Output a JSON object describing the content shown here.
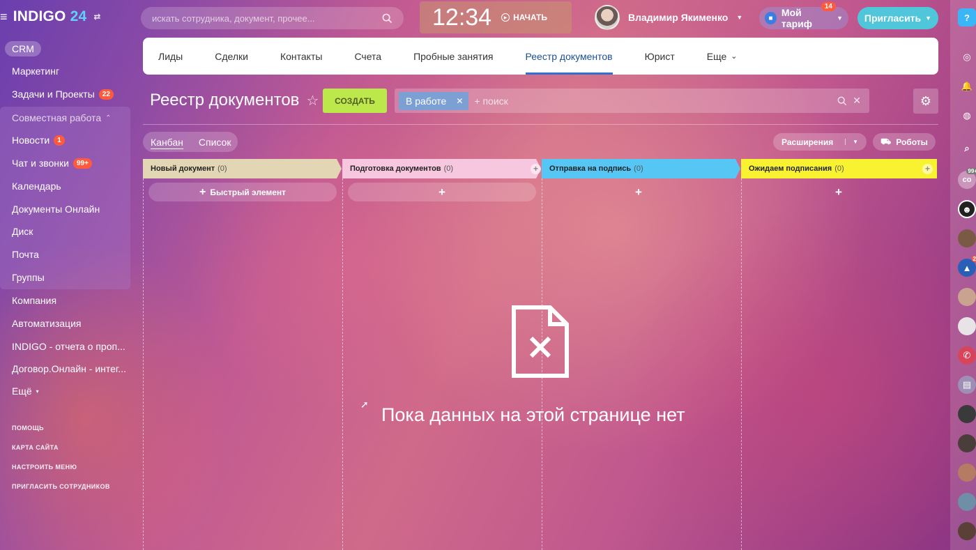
{
  "header": {
    "logo_text": "INDIGO",
    "logo_num": "24",
    "search_placeholder": "искать сотрудника, документ, прочее...",
    "time": "12:34",
    "start_label": "НАЧАТЬ",
    "user_name": "Владимир Якименко",
    "tariff_label": "Мой тариф",
    "tariff_badge": "14",
    "invite_label": "Пригласить"
  },
  "sidebar": {
    "crm": "CRM",
    "items": [
      {
        "label": "Маркетинг",
        "count": ""
      },
      {
        "label": "Задачи и Проекты",
        "count": "22"
      },
      {
        "label": "Совместная работа",
        "count": ""
      },
      {
        "label": "Новости",
        "count": "1"
      },
      {
        "label": "Чат и звонки",
        "count": "99+"
      },
      {
        "label": "Календарь",
        "count": ""
      },
      {
        "label": "Документы Онлайн",
        "count": ""
      },
      {
        "label": "Диск",
        "count": ""
      },
      {
        "label": "Почта",
        "count": ""
      },
      {
        "label": "Группы",
        "count": ""
      },
      {
        "label": "Компания",
        "count": ""
      },
      {
        "label": "Автоматизация",
        "count": ""
      },
      {
        "label": "INDIGO - отчета о проп...",
        "count": ""
      },
      {
        "label": "Договор.Онлайн - интег...",
        "count": ""
      },
      {
        "label": "Ещё",
        "count": ""
      }
    ],
    "links": [
      "ПОМОЩЬ",
      "КАРТА САЙТА",
      "НАСТРОИТЬ МЕНЮ",
      "ПРИГЛАСИТЬ СОТРУДНИКОВ"
    ]
  },
  "tabs": [
    "Лиды",
    "Сделки",
    "Контакты",
    "Счета",
    "Пробные занятия",
    "Реестр документов",
    "Юрист",
    "Еще"
  ],
  "active_tab": "Реестр документов",
  "page": {
    "title": "Реестр документов",
    "create_label": "СОЗДАТЬ",
    "filter_chip": "В работе",
    "filter_placeholder": "+ поиск"
  },
  "view": {
    "kanban": "Канбан",
    "list": "Список",
    "extensions": "Расширения",
    "robots": "Роботы"
  },
  "columns": [
    {
      "name": "Новый документ",
      "count": "(0)",
      "color": "#e2d6b4",
      "add_label": "Быстрый элемент"
    },
    {
      "name": "Подготовка документов",
      "count": "(0)",
      "color": "#f6c7df",
      "add_label": ""
    },
    {
      "name": "Отправка на подпись",
      "count": "(0)",
      "color": "#56c6f5",
      "add_label": ""
    },
    {
      "name": "Ожидаем подписания",
      "count": "(0)",
      "color": "#f8f230",
      "add_label": ""
    }
  ],
  "empty_text": "Пока данных на этой странице нет",
  "rail_badges": [
    "99+",
    "2"
  ]
}
